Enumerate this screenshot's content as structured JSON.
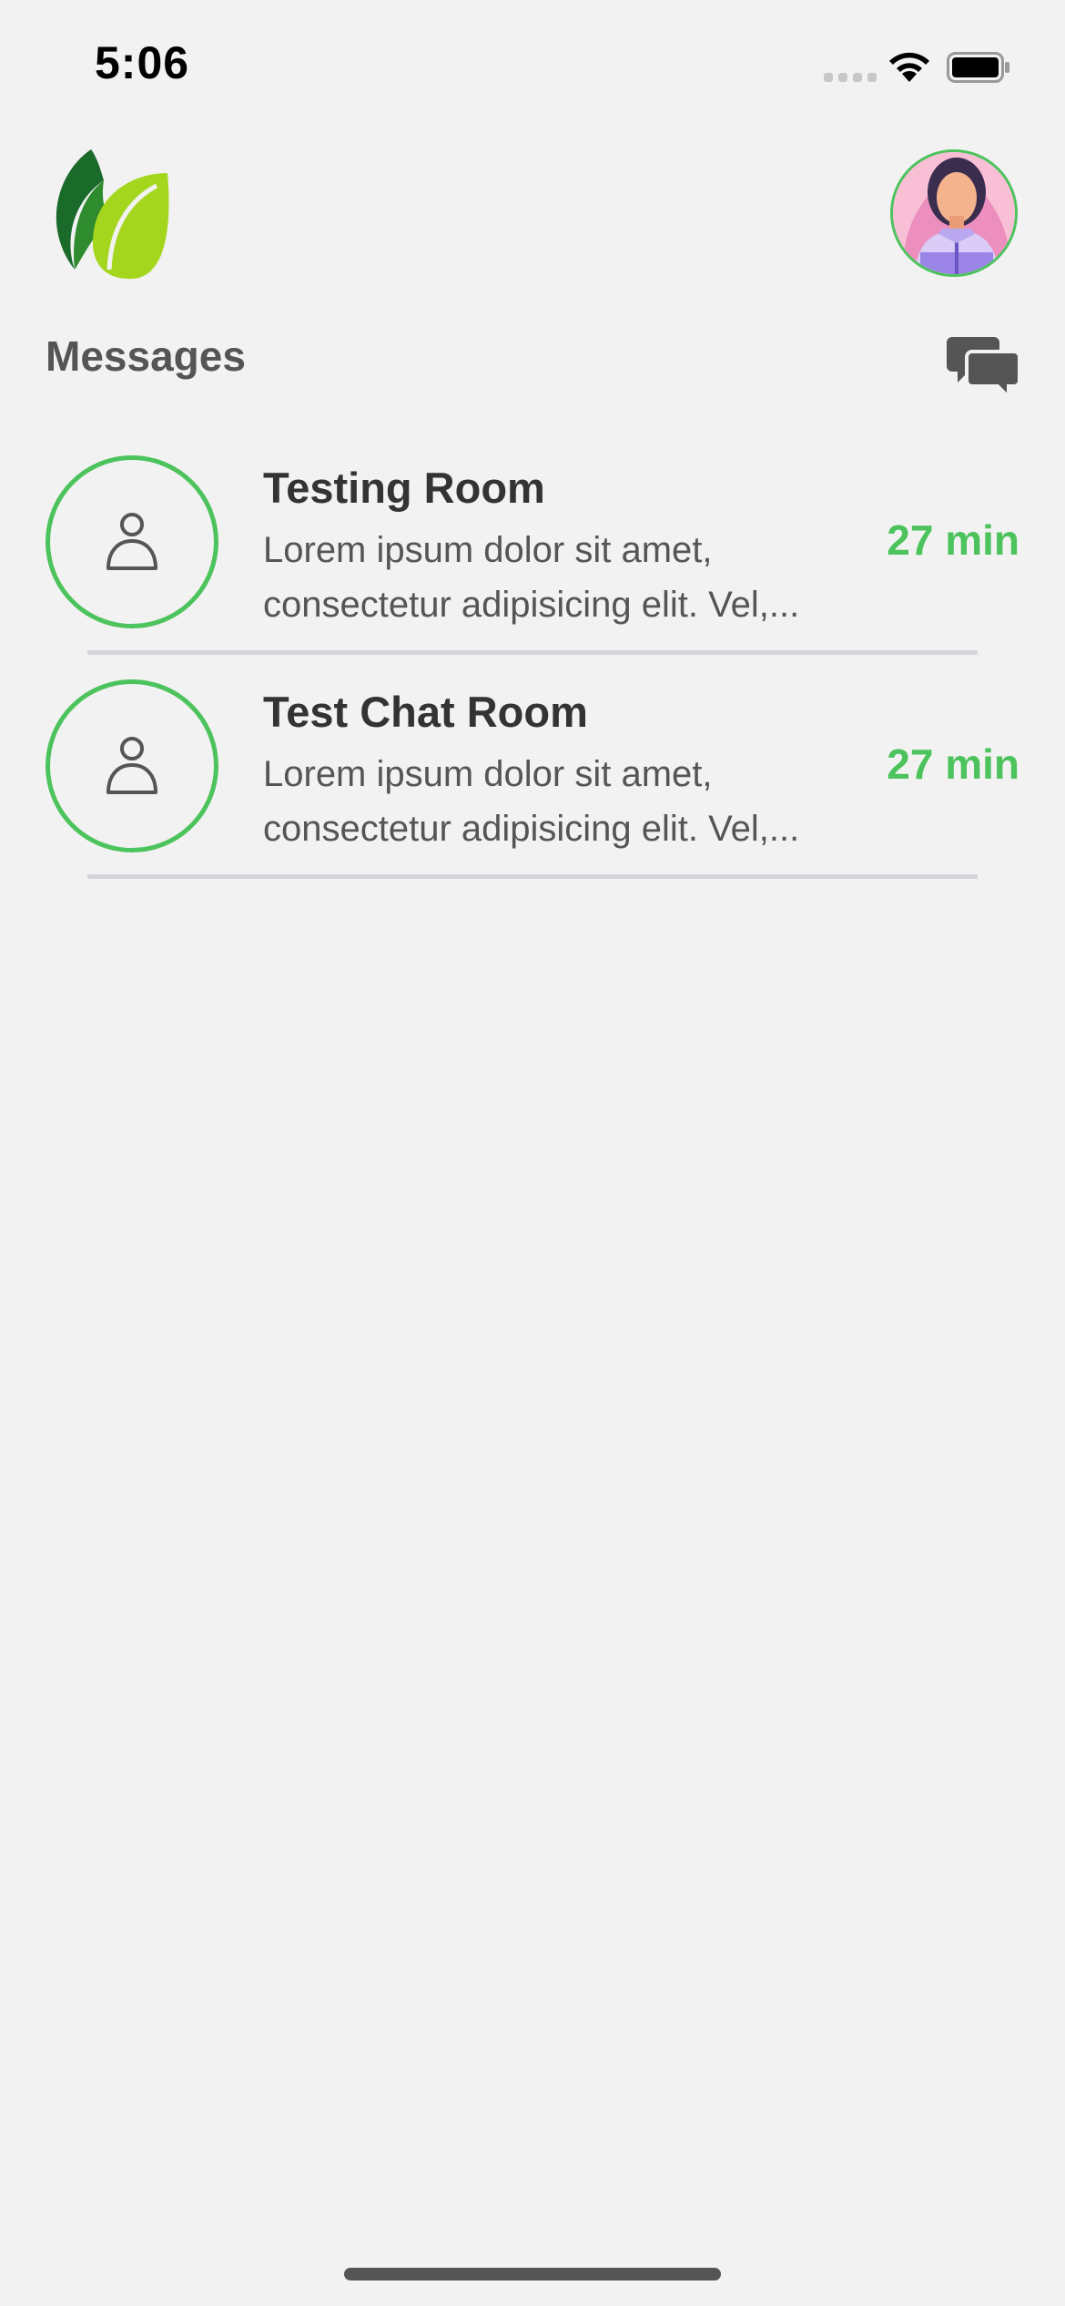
{
  "status_bar": {
    "time": "5:06"
  },
  "header": {
    "logo_icon": "leaf-logo-icon",
    "profile_icon": "user-avatar"
  },
  "messages": {
    "title": "Messages",
    "new_chat_icon": "chat-bubbles-icon",
    "rooms": [
      {
        "name": "Testing Room",
        "preview_line1": "Lorem ipsum dolor sit amet,",
        "preview_line2": "consectetur adipisicing elit. Vel,...",
        "time": "27 min",
        "avatar_icon": "person-icon"
      },
      {
        "name": "Test Chat Room",
        "preview_line1": "Lorem ipsum dolor sit amet,",
        "preview_line2": "consectetur adipisicing elit. Vel,...",
        "time": "27 min",
        "avatar_icon": "person-icon"
      }
    ]
  },
  "colors": {
    "accent_green": "#4cc35c",
    "background": "#f2f2f2",
    "divider": "#d3d4d9"
  }
}
